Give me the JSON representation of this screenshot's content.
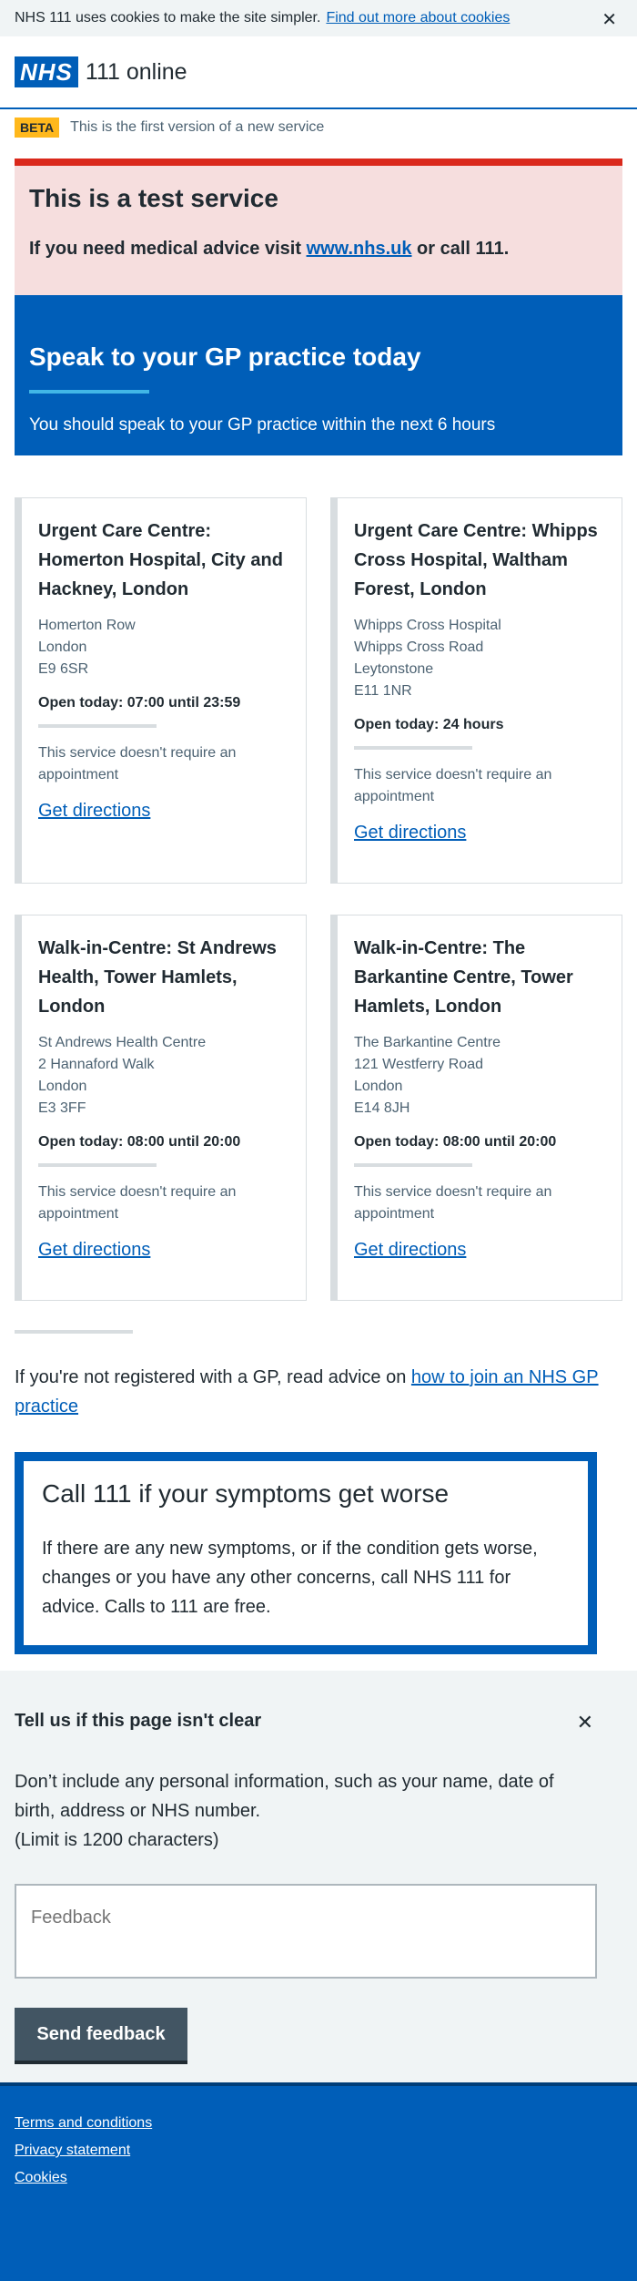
{
  "cookie_banner": {
    "text": "NHS 111 uses cookies to make the site simpler.",
    "link": "Find out more about cookies",
    "close": "✕"
  },
  "header": {
    "logo": "NHS",
    "service": "111 online"
  },
  "beta": {
    "tag": "BETA",
    "text": "This is the first version of a new service"
  },
  "test_service": {
    "title": "This is a test service",
    "text_before": "If you need medical advice visit ",
    "link": "www.nhs.uk",
    "text_after": " or call 111."
  },
  "hero": {
    "title": "Speak to your GP practice today",
    "subtitle": "You should speak to your GP practice within the next 6 hours"
  },
  "cards": [
    {
      "title": "Urgent Care Centre: Homerton Hospital, City and Hackney, London",
      "address": [
        "Homerton Row",
        "London",
        "E9 6SR"
      ],
      "open": "Open today: 07:00 until 23:59",
      "note": "This service doesn't require an appointment",
      "link": "Get directions"
    },
    {
      "title": "Urgent Care Centre: Whipps Cross Hospital, Waltham Forest, London",
      "address": [
        "Whipps Cross Hospital",
        "Whipps Cross Road",
        "Leytonstone",
        "E11 1NR"
      ],
      "open": "Open today: 24 hours",
      "note": "This service doesn't require an appointment",
      "link": "Get directions"
    },
    {
      "title": "Walk-in-Centre: St Andrews Health, Tower Hamlets, London",
      "address": [
        "St Andrews Health Centre",
        "2 Hannaford Walk",
        "London",
        "E3 3FF"
      ],
      "open": "Open today: 08:00 until 20:00",
      "note": "This service doesn't require an appointment",
      "link": "Get directions"
    },
    {
      "title": "Walk-in-Centre: The Barkantine Centre, Tower Hamlets, London",
      "address": [
        "The Barkantine Centre",
        "121 Westferry Road",
        "London",
        "E14 8JH"
      ],
      "open": "Open today: 08:00 until 20:00",
      "note": "This service doesn't require an appointment",
      "link": "Get directions"
    }
  ],
  "gp_advice": {
    "text": "If you're not registered with a GP, read advice on ",
    "link": "how to join an NHS GP practice"
  },
  "call_box": {
    "title": "Call 111 if your symptoms get worse",
    "text": "If there are any new symptoms, or if the condition gets worse, changes or you have any other concerns, call NHS 111 for advice. Calls to 111 are free."
  },
  "feedback": {
    "title": "Tell us if this page isn't clear",
    "close": "✕",
    "desc_1": "Don’t include any personal information, such as your name, date of birth, address or NHS number.",
    "desc_2": "(Limit is 1200 characters)",
    "placeholder": "Feedback",
    "button": "Send feedback"
  },
  "footer": {
    "links": [
      "Terms and conditions",
      "Privacy statement",
      "Cookies"
    ]
  },
  "colors": {
    "nhs_blue": "#005eb8",
    "red": "#da291c",
    "pink_bg": "#f6dede",
    "beta_yellow": "#ffb81c",
    "grey_bg": "#f0f4f5",
    "button_grey": "#425563"
  }
}
